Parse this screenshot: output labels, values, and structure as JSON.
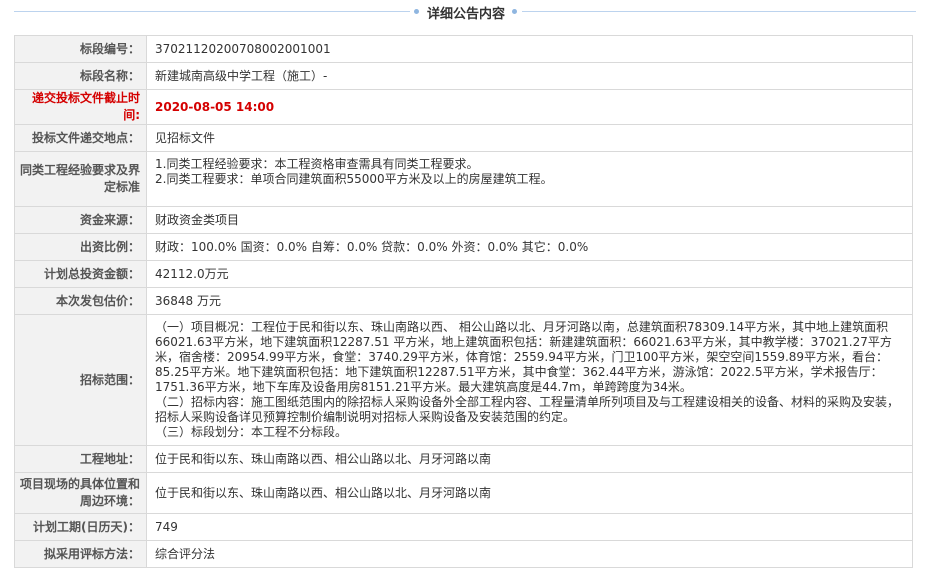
{
  "header": {
    "title": "详细公告内容"
  },
  "rows": [
    {
      "label": "标段编号：",
      "value": "370211202007080020010​01"
    },
    {
      "label": "标段名称：",
      "value": "新建城南高级中学工程（施工）-"
    },
    {
      "label": "递交投标文件截止时间:",
      "value": "2020-08-05 14:00"
    },
    {
      "label": "投标文件递交地点：",
      "value": "见招标文件"
    },
    {
      "label": "同类工程经验要求及界定标准",
      "lines": [
        "1.同类工程经验要求：本工程资格审查需具有同类工程要求。",
        "2.同类工程要求：单项合同建筑面积55000平方米及以上的房屋建筑工程。"
      ]
    },
    {
      "label": "资金来源：",
      "value": "财政资金类项目"
    },
    {
      "label": "出资比例：",
      "value": "财政：100.0% 国资：0.0% 自筹：0.0% 贷款：0.0% 外资：0.0% 其它：0.0%"
    },
    {
      "label": "计划总投资金额：",
      "value": "42112.0万元"
    },
    {
      "label": "本次发包估价：",
      "value": "36848 万元"
    },
    {
      "label": "招标范围：",
      "lines": [
        "（一）项目概况：工程位于民和街以东、珠山南路以西、 相公山路以北、月牙河路以南，总建筑面积78309.14平方米，其中地上建筑面积66021.63平方米，地下建筑面积12287.51 平方米，地上建筑面积包括：新建建筑面积：66021.63平方米，其中教学楼：37021.27平方米，宿舍楼：20954.99平方米，食堂：3740.29平方米，体育馆：2559.94平方米，门卫100平方米，架空空间1559.89平方米，看台：85.25平方米。地下建筑面积包括：地下建筑面积12287.51平方米，其中食堂：362.44平方米，游泳馆：2022.5平方米，学术报告厅：1751.36平方米，地下车库及设备用房8151.21平方米。最大建筑高度是44.7m，单跨跨度为34米。",
        "（二）招标内容：施工图纸范围内的除招标人采购设备外全部工程内容、工程量清单所列项目及与工程建设相关的设备、材料的采购及安装，招标人采购设备详见预算控制价编制说明对招标人采购设备及安装范围的约定。",
        "（三）标段划分：本工程不分标段。"
      ]
    },
    {
      "label": "工程地址：",
      "value": "位于民和街以东、珠山南路以西、相公山路以北、月牙河路以南"
    },
    {
      "label": "项目现场的具体位置和周边环境：",
      "value": "位于民和街以东、珠山南路以西、相公山路以北、月牙河路以南"
    },
    {
      "label": "计划工期(日历天)：",
      "value": "749"
    },
    {
      "label": "拟采用评标方法：",
      "value": "综合评分法"
    }
  ]
}
